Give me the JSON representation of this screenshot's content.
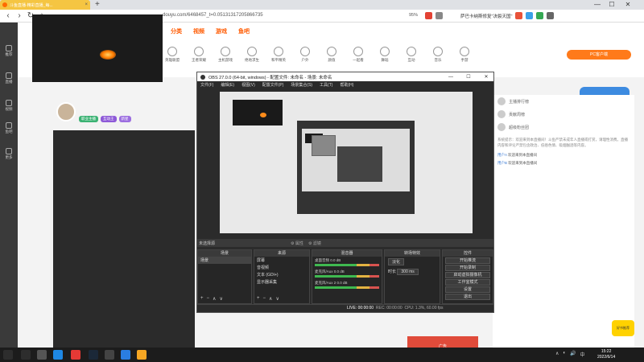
{
  "browser": {
    "tab_title": "斗鱼直播·精彩直播_每...",
    "tab_close": "×",
    "new_tab": "+",
    "url": "douyu.com/6468457_t=0.05131317205866735",
    "zoom": "95%",
    "promo": "萨巴卡纳斯修复\"决裂天国\"",
    "window_controls": [
      "—",
      "☐",
      "✕"
    ]
  },
  "site": {
    "nav": [
      "分类",
      "视频",
      "游戏",
      "鱼吧"
    ],
    "categories": [
      "英雄联盟",
      "王者荣耀",
      "主机游戏",
      "绝地求生",
      "和平精英",
      "户外",
      "颜值",
      "一起看",
      "舞蹈",
      "互动",
      "音乐",
      "手游"
    ],
    "pc_button": "PC客户端",
    "ad_right": "夏日",
    "badge_bl": "好书推荐",
    "ad_bottom": "广告",
    "rail": [
      "推荐",
      "直播",
      "视频",
      "鱼吧",
      "更多"
    ],
    "streamer_tags": [
      "职业主播",
      "互动王",
      "新星"
    ],
    "rank": [
      {
        "name": "主播排行榜"
      },
      {
        "name": "贡献周榜"
      },
      {
        "name": "超级粉丝团"
      }
    ],
    "chat_notice": "系统提示：欢迎来到本直播间！斗鱼严禁未成年人直播或打赏，请理性消费。直播内容和评论严禁包含政治、低俗色情、吸烟酗酒等内容。",
    "chat_lines": [
      {
        "name": "用户A",
        "text": "欢迎来到本直播间"
      },
      {
        "name": "用户B",
        "text": "欢迎来到本直播间"
      }
    ]
  },
  "obs": {
    "title": "OBS 27.0.0 (64-bit, windows) - 配置文件: 未命名 - 场景: 未命名",
    "menu": [
      "文件(F)",
      "编辑(E)",
      "视图(V)",
      "配置文件(P)",
      "场景集合(S)",
      "工具(T)",
      "帮助(H)"
    ],
    "window_controls": [
      "—",
      "☐",
      "✕"
    ],
    "source_bar_label": "未选择源",
    "source_bar_props": "⚙ 属性",
    "source_bar_filters": "⚙ 滤镜",
    "docks": {
      "scenes": {
        "title": "场景",
        "items": [
          "场景"
        ]
      },
      "sources": {
        "title": "来源",
        "items": [
          "屏幕",
          "音视频",
          "文本 (GDI+)",
          "显示器采集"
        ]
      },
      "mixer": {
        "title": "混音器",
        "channels": [
          {
            "name": "桌面音频",
            "level": "0.0 dB"
          },
          {
            "name": "麦克风/Aux",
            "level": "0.0 dB"
          },
          {
            "name": "麦克风/Aux 2",
            "level": "0.0 dB"
          }
        ]
      },
      "transitions": {
        "title": "转场特效",
        "type": "淡化",
        "duration_label": "时长",
        "duration": "300 ms"
      },
      "controls": {
        "title": "控件",
        "buttons": [
          "开始推流",
          "开始录制",
          "启动虚拟摄像机",
          "工作室模式",
          "设置",
          "退出"
        ]
      }
    },
    "footer_buttons": [
      "+",
      "−",
      "∧",
      "∨"
    ],
    "status": {
      "live": "LIVE: 00:00:00",
      "rec": "REC: 00:00:00",
      "cpu": "CPU: 1.3%, 60.00 fps"
    }
  },
  "taskbar": {
    "time": "15:22",
    "date": "2022/6/14",
    "tray": [
      "∧",
      "◐",
      "🔊",
      "中"
    ]
  }
}
